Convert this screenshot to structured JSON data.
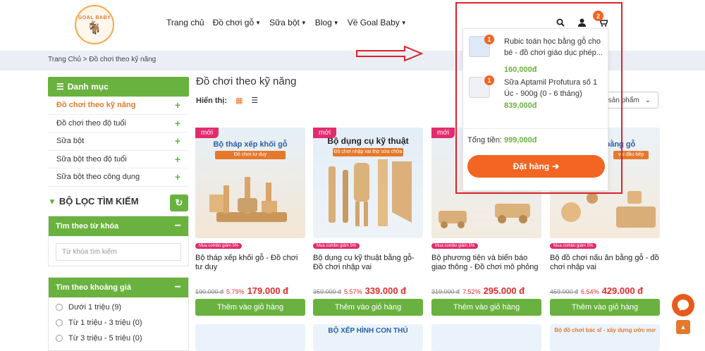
{
  "header": {
    "logo_text": "GOAL BABY",
    "nav": [
      "Trang chủ",
      "Đồ chơi gỗ",
      "Sữa bột",
      "Blog",
      "Về Goal Baby"
    ],
    "cart_count": "2"
  },
  "breadcrumb": {
    "home": "Trang Chủ",
    "sep": ">",
    "current": "Đồ chơi theo kỹ năng"
  },
  "sidebar": {
    "category_title": "Danh mục",
    "categories": [
      "Đồ chơi theo kỹ năng",
      "Đồ chơi theo độ tuổi",
      "Sữa bột",
      "Sữa bột theo độ tuổi",
      "Sữa bột theo công dụng"
    ],
    "filter_title": "BỘ LỌC TÌM KIẾM",
    "keyword_title": "Tìm theo từ khóa",
    "keyword_placeholder": "Từ khóa tìm kiếm",
    "price_title": "Tìm theo khoảng giá",
    "price_ranges": [
      "Dưới 1 triệu (9)",
      "Từ 1 triệu - 3 triệu (0)",
      "Từ 3 triệu - 5 triệu (0)"
    ]
  },
  "main": {
    "title": "Đồ chơi theo kỹ năng",
    "show_label": "Hiển thị:",
    "sort_label": "sản phẩm",
    "products": [
      {
        "badge": "mới",
        "img_title": "Bộ tháp xếp khối gỗ",
        "img_sub": "Đồ chơi tư duy",
        "combo": "Mua combo giảm 5%",
        "name": "Bộ tháp xếp khối gỗ - Đồ chơi tư duy",
        "old_price": "190.000 đ",
        "discount": "5.79%",
        "price": "179.000 đ",
        "button": "Thêm vào giỏ hàng"
      },
      {
        "badge": "mới",
        "img_title": "Bộ dụng cụ kỹ thuật",
        "img_sub": "Đồ chơi nhập vai thợ sửa chữa",
        "combo": "Mua combo giảm 5%",
        "name": "Bộ dụng cụ kỹ thuật bằng gỗ- Đồ chơi nhập vai",
        "old_price": "359.000 đ",
        "discount": "5.57%",
        "price": "339.000 đ",
        "button": "Thêm vào giỏ hàng"
      },
      {
        "badge": "mới",
        "img_title": "",
        "img_sub": "",
        "combo": "Mua combo giảm 5%",
        "name": "Bộ phương tiện và biển báo giao thông - Đồ chơi mô phỏng",
        "old_price": "319.000 đ",
        "discount": "7.52%",
        "price": "295.000 đ",
        "button": "Thêm vào giỏ hàng"
      },
      {
        "badge": "",
        "img_title": "nấu ăn bằng gỗ",
        "img_sub": "vai đầu bếp",
        "combo": "Mua combo giảm 5%",
        "name": "Bộ đồ chơi nấu ăn bằng gỗ - đồ chơi nhập vai",
        "old_price": "459.000 đ",
        "discount": "6.54%",
        "price": "429.000 đ",
        "button": "Thêm vào giỏ hàng"
      }
    ],
    "row2": [
      "",
      "BỘ XẾP HÌNH CON THÚ",
      "",
      "Bộ đồ chơi bác sĩ - xây dựng ước mơ"
    ]
  },
  "cart_dropdown": {
    "items": [
      {
        "qty": "1",
        "name": "Rubic toán học bằng gỗ cho bé - đồ chơi giáo dục phép...",
        "price": "160,000đ"
      },
      {
        "qty": "1",
        "name": "Sữa Aptamil Profutura số 1 Úc - 900g (0 - 6 tháng)",
        "price": "839,000đ"
      }
    ],
    "total_label": "Tổng tiền:",
    "total_value": "999,000đ",
    "order_button": "Đặt hàng"
  },
  "colors": {
    "green": "#6ab23f",
    "orange": "#f26522",
    "red": "#d9232a",
    "pink": "#e22b6d"
  }
}
